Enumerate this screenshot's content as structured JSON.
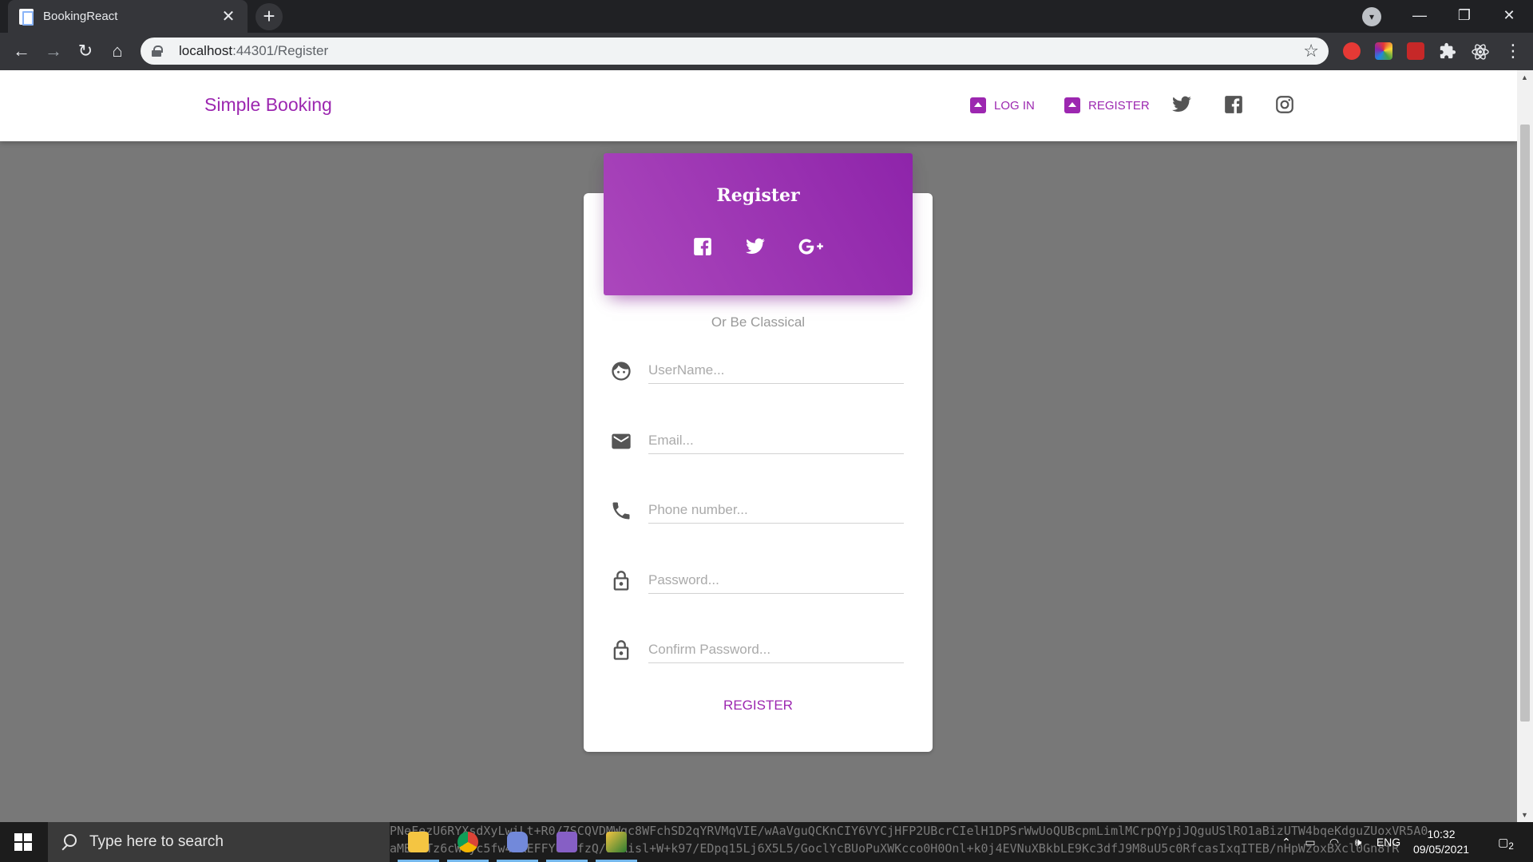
{
  "browser": {
    "tab_title": "BookingReact",
    "tab_close": "✕",
    "new_tab": "+",
    "url_host": "localhost",
    "url_path": ":44301/Register",
    "window_minimize": "—",
    "window_restore": "❐",
    "window_close": "✕"
  },
  "navbar": {
    "brand": "Simple Booking",
    "login_label": "LOG IN",
    "register_label": "REGISTER",
    "social_icons": [
      "twitter-icon",
      "facebook-icon",
      "instagram-icon"
    ]
  },
  "card": {
    "title": "Register",
    "header_socials": [
      "facebook-icon",
      "twitter-icon",
      "google-plus-icon"
    ],
    "subtitle": "Or Be Classical",
    "fields": {
      "username_placeholder": "UserName...",
      "email_placeholder": "Email...",
      "phone_placeholder": "Phone number...",
      "password_placeholder": "Password...",
      "confirm_placeholder": "Confirm Password..."
    },
    "submit_label": "REGISTER"
  },
  "taskbar": {
    "search_placeholder": "Type here to search",
    "background_text_line1": "PNeFezU6RYXsdXyLwiLt+R0/7SCQVDMWgc8WFchSD2qYRVMqVIE/wAaVguQCKnCIY6VYCjHFP2UBcrCIelH1DPSrWwUoQUBcpmLimlMCrpQYpjJQguUSlRO1aBizUTW4bqeKdguZUoxVR5A0",
    "background_text_line2": "aMBFbTz6cWCyc5fw4rKEFFYUKbfzQ/s5Aisl+W+k97/EDpq15Lj6X5L5/GoclYcBUoPuXWKcco0H0Onl+k0j4EVNuXBkbLE9Kc3dfJ9M8uU5c0RfcasIxqITEB/nHpWzoxBXcl0Gn8fR",
    "language": "ENG",
    "time": "10:32",
    "date": "09/05/2021",
    "notifications": "2"
  },
  "colors": {
    "accent": "#9c27b0",
    "header_gradient_start": "#ab47bc",
    "header_gradient_end": "#8e24aa"
  }
}
